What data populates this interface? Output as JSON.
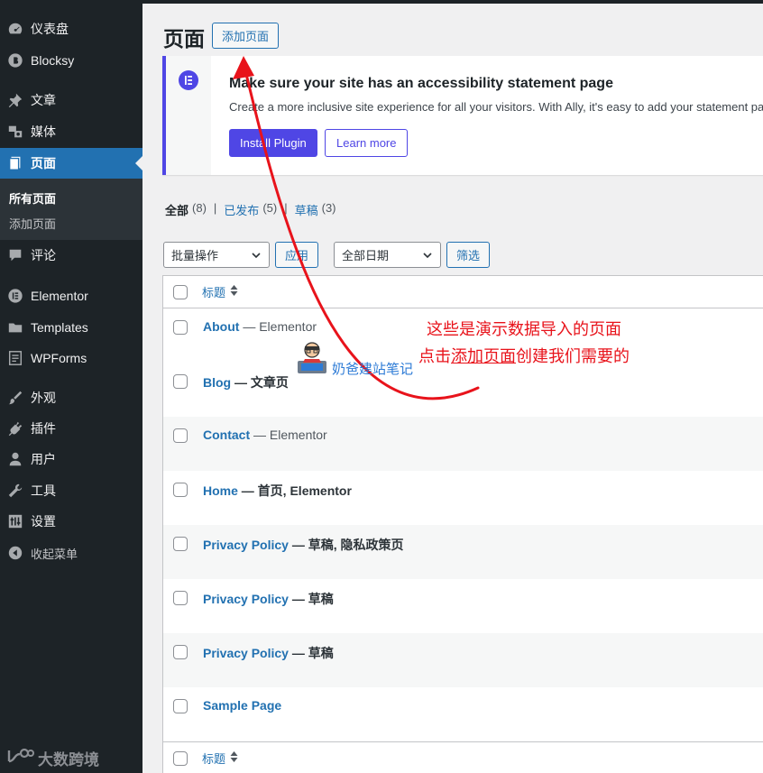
{
  "sidebar": {
    "items": [
      {
        "name": "dashboard",
        "label": "仪表盘",
        "icon": "dashboard-icon"
      },
      {
        "name": "blocksy",
        "label": "Blocksy",
        "icon": "blocksy-icon"
      },
      {
        "name": "posts",
        "label": "文章",
        "icon": "pin-icon"
      },
      {
        "name": "media",
        "label": "媒体",
        "icon": "media-icon"
      },
      {
        "name": "pages",
        "label": "页面",
        "icon": "page-icon"
      },
      {
        "name": "comments",
        "label": "评论",
        "icon": "comment-icon"
      },
      {
        "name": "elementor",
        "label": "Elementor",
        "icon": "elementor-icon"
      },
      {
        "name": "templates",
        "label": "Templates",
        "icon": "folder-icon"
      },
      {
        "name": "wpforms",
        "label": "WPForms",
        "icon": "form-icon"
      },
      {
        "name": "appearance",
        "label": "外观",
        "icon": "brush-icon"
      },
      {
        "name": "plugins",
        "label": "插件",
        "icon": "plug-icon"
      },
      {
        "name": "users",
        "label": "用户",
        "icon": "user-icon"
      },
      {
        "name": "tools",
        "label": "工具",
        "icon": "wrench-icon"
      },
      {
        "name": "settings",
        "label": "设置",
        "icon": "settings-icon"
      },
      {
        "name": "collapse",
        "label": "收起菜单",
        "icon": "collapse-icon"
      }
    ],
    "submenu": {
      "all_pages": "所有页面",
      "add_page": "添加页面"
    },
    "watermark": "大数跨境"
  },
  "header": {
    "title": "页面",
    "add_new": "添加页面"
  },
  "notice": {
    "title": "Make sure your site has an accessibility statement page",
    "description": "Create a more inclusive site experience for all your visitors. With Ally, it's easy to add your statement page",
    "install_label": "Install Plugin",
    "learn_label": "Learn more"
  },
  "views": [
    {
      "label": "全部",
      "count": "(8)"
    },
    {
      "label": "已发布",
      "count": "(5)"
    },
    {
      "label": "草稿",
      "count": "(3)"
    }
  ],
  "bulk": {
    "select": "批量操作",
    "apply": "应用"
  },
  "date_filter": {
    "select": "全部日期",
    "filter": "筛选"
  },
  "table": {
    "header_title": "标题",
    "rows": [
      {
        "title": "About",
        "state": " — Elementor"
      },
      {
        "title": "Blog",
        "state": " — 文章页"
      },
      {
        "title": "Contact",
        "state": " — Elementor"
      },
      {
        "title": "Home",
        "state": " — 首页, Elementor"
      },
      {
        "title": "Privacy Policy",
        "state": " — 草稿, 隐私政策页"
      },
      {
        "title": "Privacy Policy",
        "state": " — 草稿"
      },
      {
        "title": "Privacy Policy",
        "state": " — 草稿"
      },
      {
        "title": "Sample Page",
        "state": ""
      }
    ]
  },
  "annotation": {
    "line1": "这些是演示数据导入的页面",
    "line2_pre": "点击",
    "line2_link": "添加页面",
    "line2_post": "创建我们需要的",
    "watermark": "奶爸建站笔记"
  },
  "colors": {
    "admin_bar": "#1d2327",
    "accent": "#2271b1",
    "ally": "#4f46e5",
    "annotation": "#e8131b"
  }
}
